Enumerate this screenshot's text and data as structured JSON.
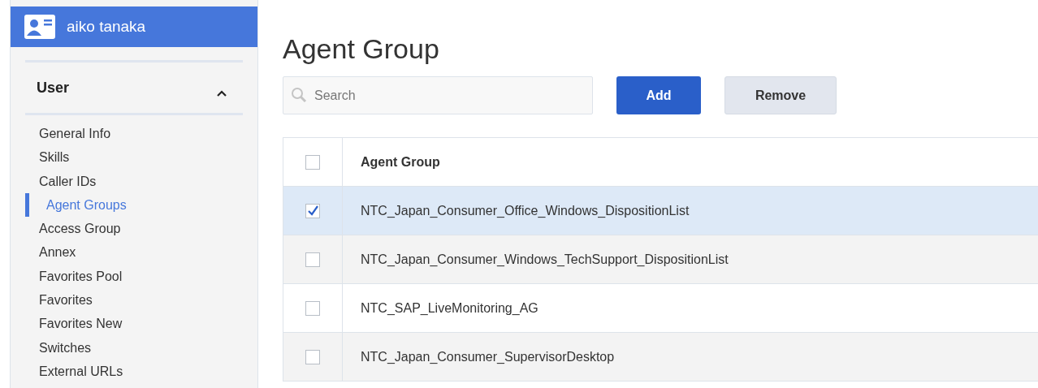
{
  "user": {
    "name": "aiko tanaka"
  },
  "sidebar": {
    "section": "User",
    "expanded": true,
    "items": [
      {
        "label": "General Info",
        "selected": false
      },
      {
        "label": "Skills",
        "selected": false
      },
      {
        "label": "Caller IDs",
        "selected": false
      },
      {
        "label": "Agent Groups",
        "selected": true
      },
      {
        "label": "Access Group",
        "selected": false
      },
      {
        "label": "Annex",
        "selected": false
      },
      {
        "label": "Favorites Pool",
        "selected": false
      },
      {
        "label": "Favorites",
        "selected": false
      },
      {
        "label": "Favorites New",
        "selected": false
      },
      {
        "label": "Switches",
        "selected": false
      },
      {
        "label": "External URLs",
        "selected": false
      }
    ]
  },
  "page_title": "Agent Group",
  "search": {
    "placeholder": "Search"
  },
  "buttons": [
    {
      "label": "Add",
      "kind": "primary"
    },
    {
      "label": "Remove",
      "kind": "secondary"
    }
  ],
  "table": {
    "columns": [
      "Agent Group"
    ],
    "header_checked": false,
    "rows": [
      {
        "name": "NTC_Japan_Consumer_Office_Windows_DispositionList",
        "checked": true,
        "selected": true
      },
      {
        "name": "NTC_Japan_Consumer_Windows_TechSupport_DispositionList",
        "checked": false,
        "selected": false
      },
      {
        "name": "NTC_SAP_LiveMonitoring_AG",
        "checked": false,
        "selected": false
      },
      {
        "name": "NTC_Japan_Consumer_SupervisorDesktop",
        "checked": false,
        "selected": false
      }
    ]
  }
}
